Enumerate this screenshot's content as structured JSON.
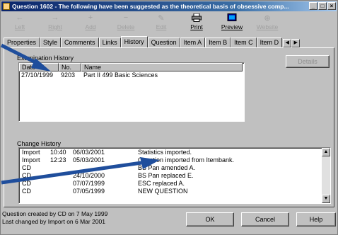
{
  "window": {
    "title": "Question 1602 - The following have been suggested as the theoretical basis of obsessive comp..."
  },
  "toolbar": {
    "items": [
      {
        "label": "Left",
        "icon": "left-arrow-icon",
        "enabled": false
      },
      {
        "label": "Right",
        "icon": "right-arrow-icon",
        "enabled": false
      },
      {
        "label": "Add",
        "icon": "add-icon",
        "enabled": false
      },
      {
        "label": "Delete",
        "icon": "delete-icon",
        "enabled": false
      },
      {
        "label": "Edit",
        "icon": "edit-icon",
        "enabled": false
      },
      {
        "label": "Print",
        "icon": "printer-icon",
        "enabled": true
      },
      {
        "label": "Preview",
        "icon": "preview-icon",
        "enabled": true
      },
      {
        "label": "Website",
        "icon": "website-icon",
        "enabled": false
      }
    ]
  },
  "tabs": [
    "Properties",
    "Style",
    "Comments",
    "Links",
    "History",
    "Question",
    "Item A",
    "Item B",
    "Item C",
    "Item D"
  ],
  "active_tab": "History",
  "examination_history": {
    "label": "Examination History",
    "columns": [
      "Date",
      "No.",
      "Name"
    ],
    "rows": [
      {
        "date": "27/10/1999",
        "no": "9203",
        "name": "Part II 499 Basic Sciences"
      }
    ],
    "details_button": "Details"
  },
  "change_history": {
    "label": "Change History",
    "rows": [
      {
        "who": "Import",
        "time": "10:40",
        "date": "06/03/2001",
        "desc": "Statistics imported."
      },
      {
        "who": "Import",
        "time": "12:23",
        "date": "05/03/2001",
        "desc": "Question imported from Itembank."
      },
      {
        "who": "CD",
        "time": "",
        "date": "",
        "desc": "BS Pan amended A."
      },
      {
        "who": "CD",
        "time": "",
        "date": "24/10/2000",
        "desc": "BS Pan replaced E."
      },
      {
        "who": "CD",
        "time": "",
        "date": "07/07/1999",
        "desc": "ESC replaced A."
      },
      {
        "who": "CD",
        "time": "",
        "date": "07/05/1999",
        "desc": "NEW QUESTION"
      }
    ]
  },
  "status": {
    "line1": "Question created by CD on 7 May 1999",
    "line2": "Last changed by Import on 6 Mar 2001"
  },
  "buttons": {
    "ok": "OK",
    "cancel": "Cancel",
    "help": "Help"
  },
  "colors": {
    "arrow": "#1f4e9c",
    "title_bar": "#0a246a"
  }
}
